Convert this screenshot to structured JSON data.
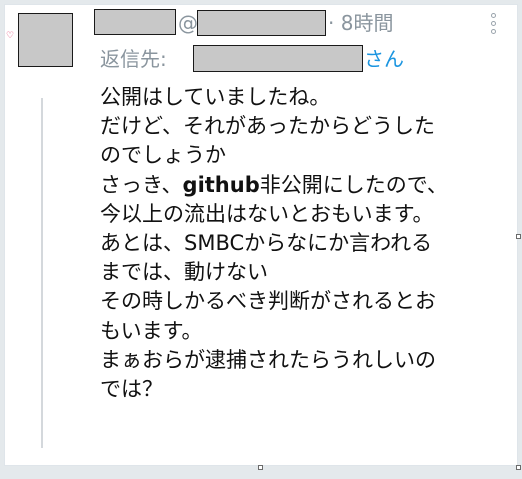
{
  "tweet": {
    "handle_at": "@",
    "timestamp_sep": "·",
    "timestamp": "8時間",
    "reply_to_prefix": "返信先:",
    "reply_to_suffix": "さん",
    "body_lines": [
      {
        "segments": [
          {
            "text": "公開はしていましたね。"
          }
        ]
      },
      {
        "segments": [
          {
            "text": "だけど、それがあったからどうした"
          }
        ]
      },
      {
        "segments": [
          {
            "text": "のでしょうか"
          }
        ]
      },
      {
        "segments": [
          {
            "text": "さっき、"
          },
          {
            "text": "github",
            "bold": true
          },
          {
            "text": "非公開にしたので、"
          }
        ]
      },
      {
        "segments": [
          {
            "text": "今以上の流出はないとおもいます。"
          }
        ]
      },
      {
        "segments": [
          {
            "text": "あとは、SMBCからなにか言われる"
          }
        ]
      },
      {
        "segments": [
          {
            "text": "までは、動けない"
          }
        ]
      },
      {
        "segments": [
          {
            "text": "その時しかるべき判断がされるとお"
          }
        ]
      },
      {
        "segments": [
          {
            "text": "もいます。"
          }
        ]
      },
      {
        "segments": [
          {
            "text": "まぁおらが逮捕されたらうれしいの"
          }
        ]
      },
      {
        "segments": [
          {
            "text": "では？"
          }
        ]
      }
    ]
  },
  "colors": {
    "meta_gray": "#8a959e",
    "link_blue": "#1b95e0",
    "body_text": "#111111",
    "redaction_fill": "#c8c8c8"
  },
  "icons": {
    "more": "more-vertical-icon",
    "heart": "heart-icon"
  }
}
